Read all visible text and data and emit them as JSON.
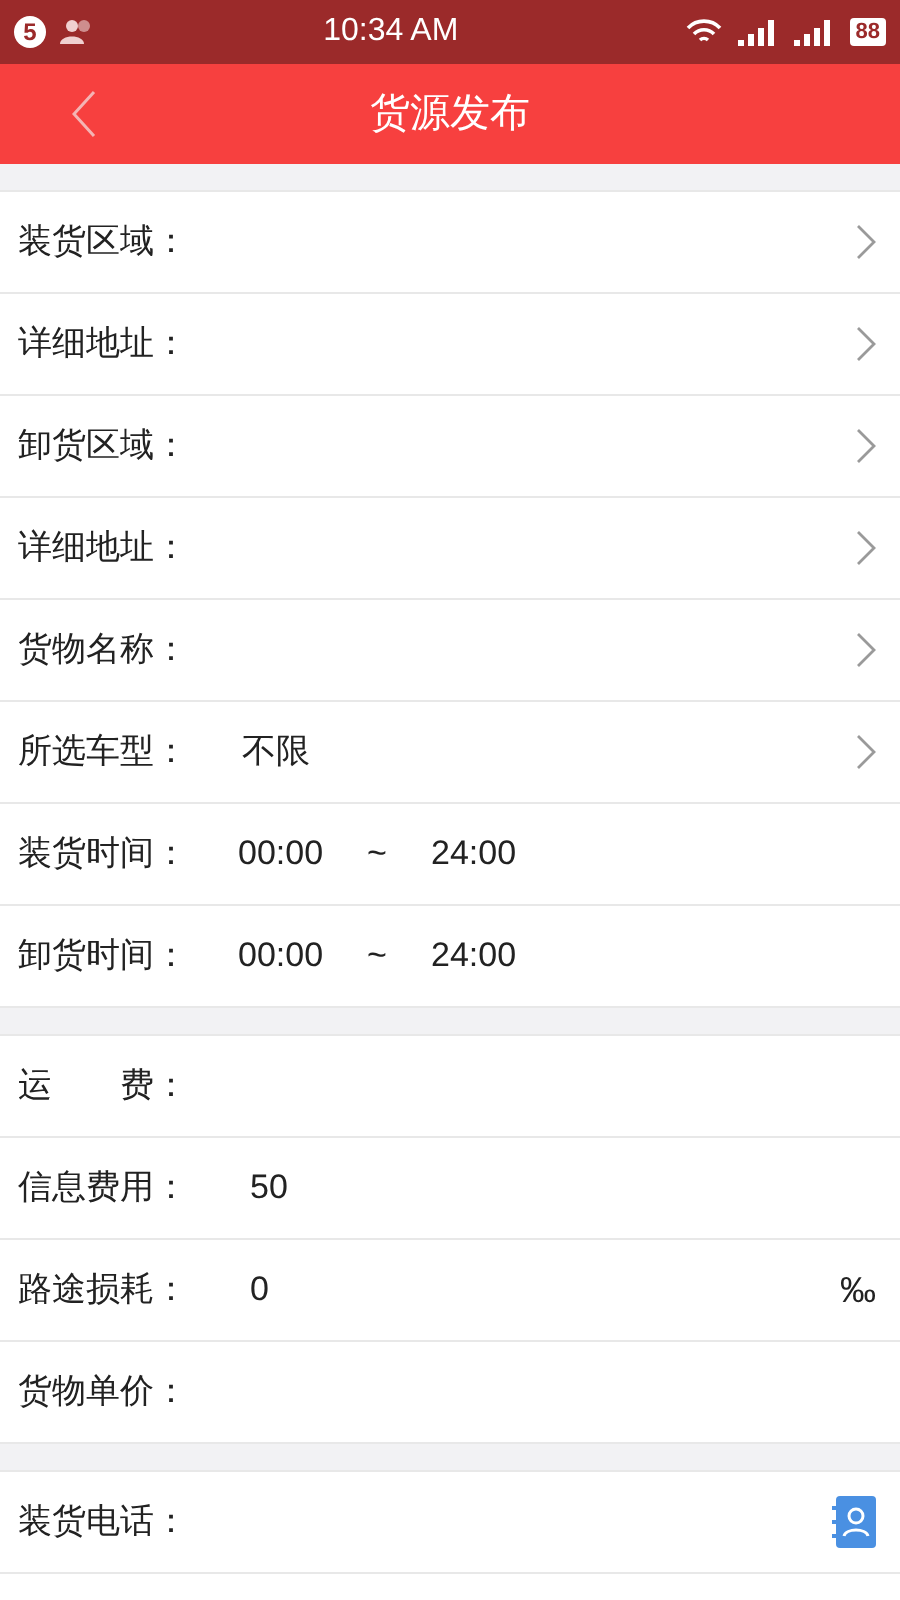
{
  "status_bar": {
    "notification_count": "5",
    "time": "10:34 AM",
    "battery": "88"
  },
  "header": {
    "title": "货源发布"
  },
  "groups": [
    {
      "rows": [
        {
          "kind": "select",
          "label": "装货区域："
        },
        {
          "kind": "select",
          "label": "详细地址："
        },
        {
          "kind": "select",
          "label": "卸货区域："
        },
        {
          "kind": "select",
          "label": "详细地址："
        },
        {
          "kind": "select",
          "label": "货物名称："
        },
        {
          "kind": "select",
          "label": "所选车型：",
          "value": "不限"
        },
        {
          "kind": "time",
          "label": "装货时间：",
          "start": "00:00",
          "separator": "~",
          "end": "24:00"
        },
        {
          "kind": "time",
          "label": "卸货时间：",
          "start": "00:00",
          "separator": "~",
          "end": "24:00"
        }
      ]
    },
    {
      "rows": [
        {
          "kind": "input",
          "label": "运　　费："
        },
        {
          "kind": "input",
          "label": "信息费用：",
          "value": "50"
        },
        {
          "kind": "input",
          "label": "路途损耗：",
          "value": "0",
          "unit": "‰"
        },
        {
          "kind": "input",
          "label": "货物单价："
        }
      ]
    },
    {
      "rows": [
        {
          "kind": "contact",
          "label": "装货电话："
        }
      ]
    }
  ]
}
